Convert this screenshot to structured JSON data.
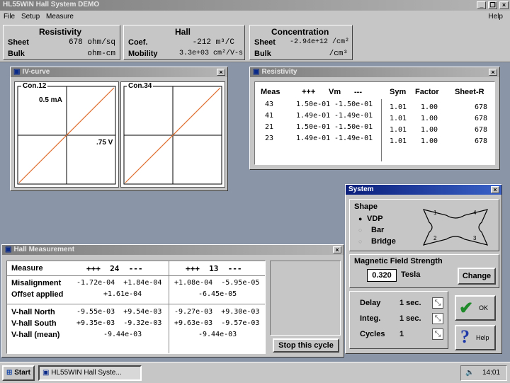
{
  "app": {
    "title": "HL55WIN Hall System DEMO",
    "help_menu": "Help",
    "menu": [
      "File",
      "Setup",
      "Measure"
    ]
  },
  "summary": {
    "resistivity": {
      "title": "Resistivity",
      "sheet_label": "Sheet",
      "sheet_value": "678 ohm/sq",
      "bulk_label": "Bulk",
      "bulk_value": "ohm-cm"
    },
    "hall": {
      "title": "Hall",
      "coef_label": "Coef.",
      "coef_value": "-212 m³/C",
      "mobility_label": "Mobility",
      "mobility_value": "3.3e+03 cm²/V-s"
    },
    "concentration": {
      "title": "Concentration",
      "sheet_label": "Sheet",
      "sheet_value": "-2.94e+12 /cm²",
      "bulk_label": "Bulk",
      "bulk_value": "/cm³"
    }
  },
  "iv_window": {
    "title": "IV-curve",
    "left_plot": {
      "label": "Con.12",
      "current": "0.5 mA",
      "voltage": ".75 V"
    },
    "right_plot": {
      "label": "Con.34"
    }
  },
  "resistivity_window": {
    "title": "Resistivity",
    "headers": [
      "Meas",
      "+++",
      "Vm",
      "---",
      "Sym",
      "Factor",
      "Sheet-R"
    ],
    "rows": [
      [
        "43",
        "1.50e-01",
        "-1.50e-01",
        "1.01",
        "1.00",
        "678"
      ],
      [
        "41",
        "1.49e-01",
        "-1.49e-01",
        "1.01",
        "1.00",
        "678"
      ],
      [
        "21",
        "1.50e-01",
        "-1.50e-01",
        "1.01",
        "1.00",
        "678"
      ],
      [
        "23",
        "1.49e-01",
        "-1.49e-01",
        "1.01",
        "1.00",
        "678"
      ]
    ]
  },
  "system_window": {
    "title": "System",
    "shape_label": "Shape",
    "shapes": [
      "VDP",
      "Bar",
      "Bridge"
    ],
    "contacts": [
      "1",
      "4",
      "2",
      "3"
    ],
    "field_label": "Magnetic Field Strength",
    "field_value": "0.320",
    "field_unit": "Tesla",
    "change_label": "Change",
    "delay_label": "Delay",
    "delay_value": "1 sec.",
    "integ_label": "Integ.",
    "integ_value": "1 sec.",
    "cycles_label": "Cycles",
    "cycles_value": "1",
    "ok_label": "OK",
    "help_label": "Help"
  },
  "hall_window": {
    "title": "Hall Measurement",
    "measure_label": "Measure",
    "col1_header": "+++  24  ---",
    "col2_header": "+++  13  ---",
    "rows": [
      {
        "label": "Misalignment",
        "c1": "-1.72e-04  +1.84e-04",
        "c2": "+1.08e-04  -5.95e-05"
      },
      {
        "label": "Offset applied",
        "c1": "+1.61e-04",
        "c2": "-6.45e-05"
      },
      {
        "label": "V-hall North",
        "c1": "-9.55e-03  +9.54e-03",
        "c2": "-9.27e-03  +9.30e-03"
      },
      {
        "label": "V-hall South",
        "c1": "+9.35e-03  -9.32e-03",
        "c2": "+9.63e-03  -9.57e-03"
      },
      {
        "label": "V-hall (mean)",
        "c1": "-9.44e-03",
        "c2": "-9.44e-03"
      }
    ],
    "stop_label": "Stop this cycle"
  },
  "taskbar": {
    "start_label": "Start",
    "task_label": "HL55WIN Hall Syste...",
    "clock": "14:01"
  }
}
